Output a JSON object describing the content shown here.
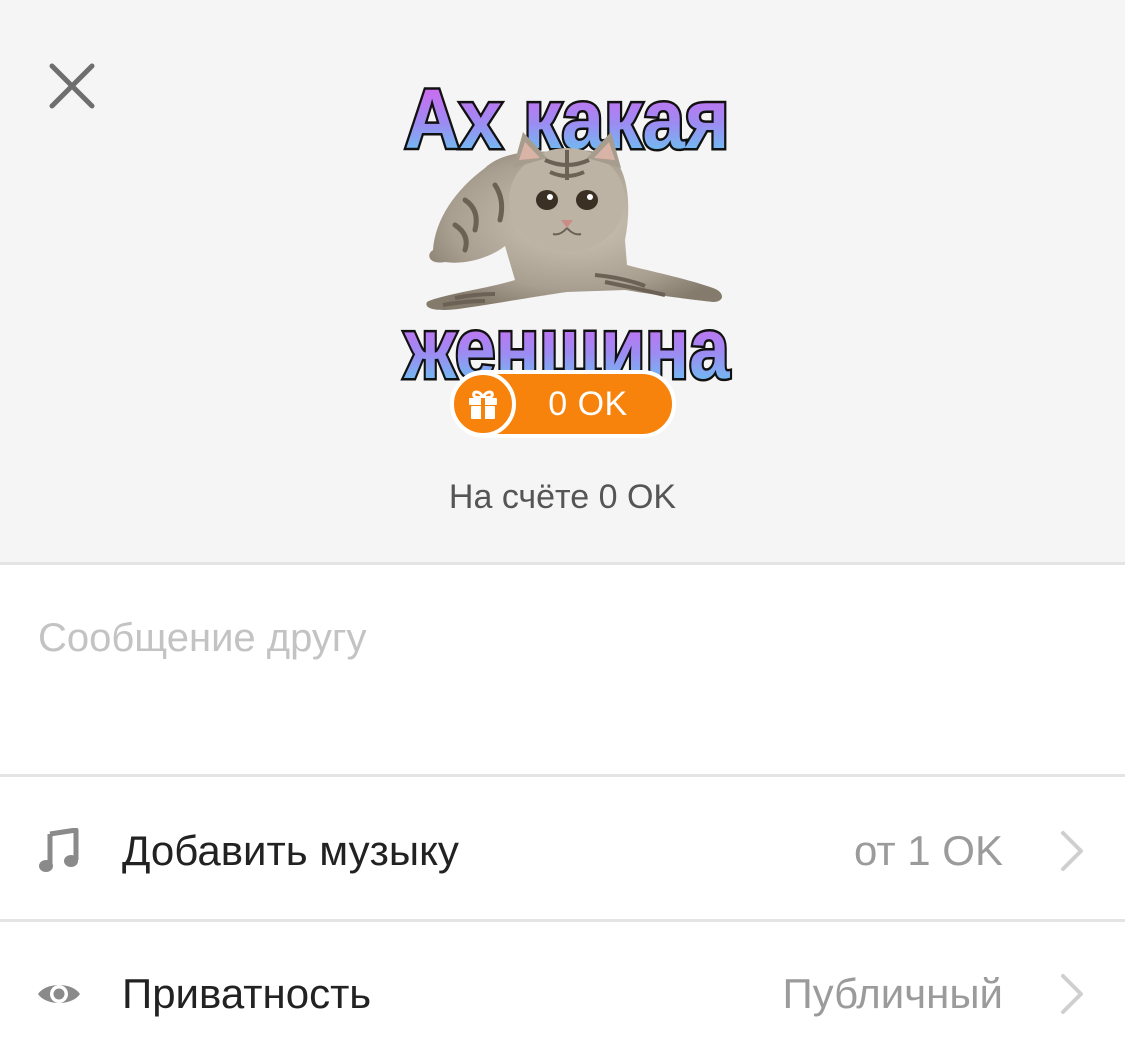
{
  "sticker": {
    "line1": "Ах какая",
    "line2": "женщина",
    "icon": "kitten-sticker"
  },
  "price": {
    "label": "0 OK",
    "icon": "gift-icon",
    "color": "#f7820c"
  },
  "balance": {
    "text": "На счёте 0 OK"
  },
  "message": {
    "placeholder": "Сообщение другу",
    "value": ""
  },
  "options": [
    {
      "icon": "music-note-icon",
      "label": "Добавить музыку",
      "value": "от 1 OK"
    },
    {
      "icon": "eye-icon",
      "label": "Приватность",
      "value": "Публичный"
    }
  ],
  "colors": {
    "header_bg": "#f5f5f5",
    "accent": "#f7820c",
    "icon_gray": "#8a8a8a"
  }
}
